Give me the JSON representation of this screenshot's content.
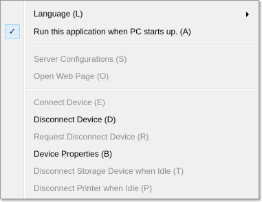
{
  "menu": {
    "items": [
      {
        "label": "Language (L)",
        "enabled": true,
        "submenu": true,
        "checked": false
      },
      {
        "label": "Run this application when PC starts up. (A)",
        "enabled": true,
        "submenu": false,
        "checked": true
      },
      {
        "label": "Server Configurations (S)",
        "enabled": false
      },
      {
        "label": "Open Web Page (O)",
        "enabled": false
      },
      {
        "label": "Connect Device (E)",
        "enabled": false
      },
      {
        "label": "Disconnect Device (D)",
        "enabled": true
      },
      {
        "label": "Request Disconnect Device (R)",
        "enabled": false
      },
      {
        "label": "Device Properties (B)",
        "enabled": true
      },
      {
        "label": "Disconnect Storage Device when Idle (T)",
        "enabled": false
      },
      {
        "label": "Disconnect Printer when Idle (P)",
        "enabled": false
      }
    ],
    "check_glyph": "✓",
    "colors": {
      "background": "#f0f0f0",
      "disabled_text": "#8d8d8d",
      "enabled_text": "#000000",
      "check_highlight": "#dcecfc",
      "border": "#979797"
    }
  }
}
